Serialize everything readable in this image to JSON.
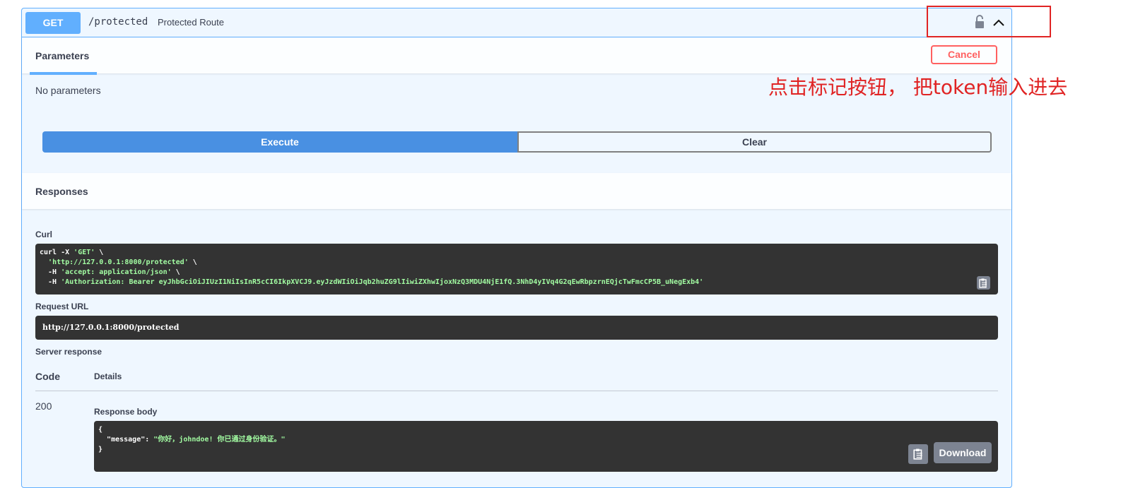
{
  "operation": {
    "method": "GET",
    "path": "/protected",
    "summary": "Protected Route"
  },
  "icons": {
    "lock": "lock-icon",
    "collapse": "chevron-up-icon",
    "copy": "clipboard-icon"
  },
  "parameters": {
    "tab_label": "Parameters",
    "cancel_label": "Cancel",
    "empty_text": "No parameters"
  },
  "actions": {
    "execute_label": "Execute",
    "clear_label": "Clear"
  },
  "responses": {
    "header": "Responses",
    "curl_label": "Curl",
    "curl_lines": [
      {
        "plain": "curl -X ",
        "str": "'GET'",
        "tail": " \\"
      },
      {
        "plain": "  ",
        "str": "'http://127.0.0.1:8000/protected'",
        "tail": " \\"
      },
      {
        "plain": "  -H ",
        "str": "'accept: application/json'",
        "tail": " \\"
      },
      {
        "plain": "  -H ",
        "str": "'Authorization: Bearer eyJhbGciOiJIUzI1NiIsInR5cCI6IkpXVCJ9.eyJzdWIiOiJqb2huZG9lIiwiZXhwIjoxNzQ3MDU4NjE1fQ.3NhD4yIVq4G2qEwRbpzrnEQjcTwFmcCP5B_uNegExb4'",
        "tail": ""
      }
    ],
    "request_url_label": "Request URL",
    "request_url": "http://127.0.0.1:8000/protected",
    "server_response_label": "Server response",
    "code_header": "Code",
    "details_header": "Details",
    "status_code": "200",
    "response_body_label": "Response body",
    "response_body_lines": [
      {
        "plain": "{",
        "key": "",
        "str": ""
      },
      {
        "plain": "  ",
        "key": "\"message\": ",
        "str": "\"你好，johndoe! 你已通过身份验证。\""
      },
      {
        "plain": "}",
        "key": "",
        "str": ""
      }
    ],
    "download_label": "Download"
  },
  "annotation": {
    "text": "点击标记按钮， 把token输入进去",
    "color": "#e02424"
  },
  "colors": {
    "get_blue": "#61affe",
    "execute_blue": "#4990e2",
    "cancel_red": "#ff6060",
    "code_bg": "#333333",
    "code_string": "#a2fca2"
  }
}
